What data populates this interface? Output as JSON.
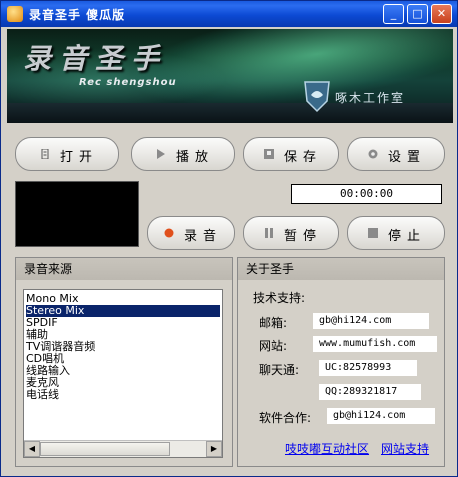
{
  "window": {
    "title": "录音圣手 傻瓜版",
    "accent": "#0a46d0"
  },
  "titlebar_buttons": {
    "minimize": "_",
    "maximize": "□",
    "close": "✕"
  },
  "banner": {
    "logo_cn": "录音圣手",
    "logo_en": "Rec shengshou",
    "studio": "啄木工作室"
  },
  "toolbar": {
    "open": "打开",
    "play": "播放",
    "save": "保存",
    "settings": "设置"
  },
  "controls": {
    "record": "录音",
    "pause": "暂停",
    "stop": "停止"
  },
  "timer": "00:00:00",
  "source_panel": {
    "title": "录音来源",
    "items": [
      "Mono Mix",
      "Stereo Mix",
      "SPDIF",
      "辅助",
      "TV调谐器音频",
      "CD唱机",
      "线路输入",
      "麦克风",
      "电话线"
    ],
    "selected": "Stereo Mix"
  },
  "about_panel": {
    "title": "关于圣手",
    "support_label": "技术支持:",
    "mail_label": "邮箱:",
    "mail_value": "gb@hi124.com",
    "site_label": "网站:",
    "site_value": "www.mumufish.com",
    "chat_label": "聊天通:",
    "uc_value": "UC:82578993",
    "qq_value": "QQ:289321817",
    "coop_label": "软件合作:",
    "coop_value": "gb@hi124.com",
    "community_link": "吱吱嘟互动社区",
    "support_link": "网站支持"
  }
}
